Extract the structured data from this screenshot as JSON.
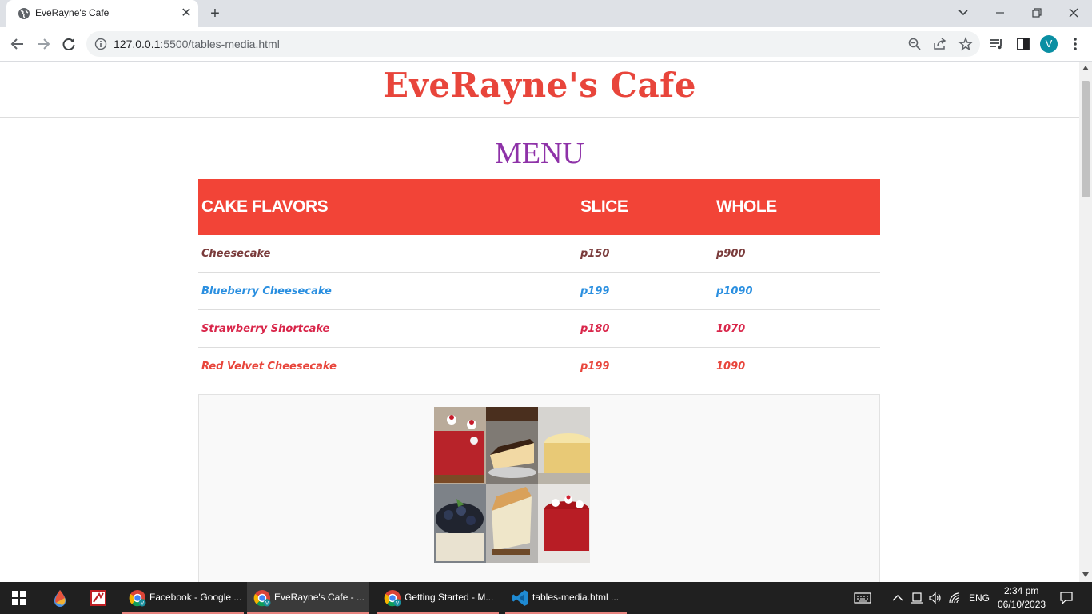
{
  "browser": {
    "tab_title": "EveRayne's Cafe",
    "url_host": "127.0.0.1",
    "url_rest": ":5500/tables-media.html",
    "profile_initial": "V"
  },
  "page": {
    "site_title": "EveRayne's Cafe",
    "menu_heading": "MENU",
    "table": {
      "headers": [
        "CAKE FLAVORS",
        "SLICE",
        "WHOLE"
      ],
      "rows": [
        {
          "flavor": "Cheesecake",
          "slice": "p150",
          "whole": "p900",
          "color": "#7a3b3b"
        },
        {
          "flavor": "Blueberry Cheesecake",
          "slice": "p199",
          "whole": "p1090",
          "color": "#2a8fe0"
        },
        {
          "flavor": "Strawberry Shortcake",
          "slice": "p180",
          "whole": "1070",
          "color": "#d9264a"
        },
        {
          "flavor": "Red Velvet Cheesecake",
          "slice": "p199",
          "whole": "1090",
          "color": "#e8453b"
        }
      ]
    },
    "header_color": "#f24437",
    "title_color": "#e8453b",
    "menu_color": "#8e32a8"
  },
  "taskbar": {
    "apps": [
      {
        "label": "Facebook - Google ...",
        "icon": "chrome-icon"
      },
      {
        "label": "EveRayne's Cafe - ...",
        "icon": "chrome-icon"
      },
      {
        "label": "Getting Started - M...",
        "icon": "chrome-icon"
      },
      {
        "label": "tables-media.html ...",
        "icon": "vscode-icon"
      }
    ],
    "language": "ENG",
    "time": "2:34 pm",
    "date": "06/10/2023"
  }
}
